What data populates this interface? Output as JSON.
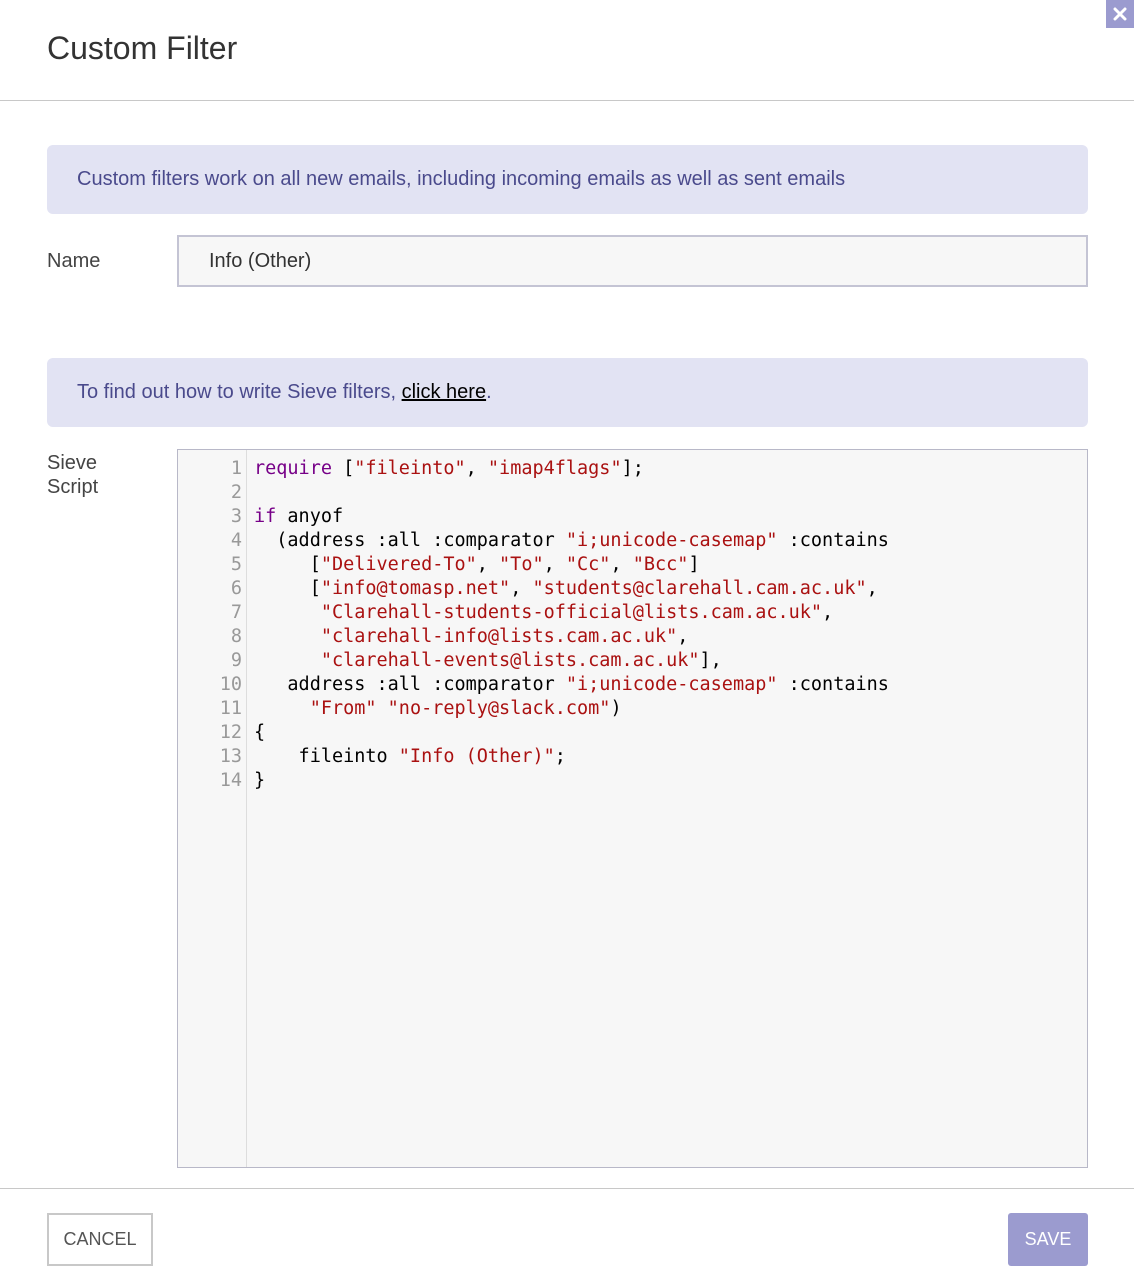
{
  "dialog": {
    "title": "Custom Filter",
    "close_icon": "close-icon"
  },
  "info_banner": {
    "text": "Custom filters work on all new emails, including incoming emails as well as sent emails"
  },
  "name_field": {
    "label": "Name",
    "value": "Info (Other)"
  },
  "help_banner": {
    "prefix": "To find out how to write Sieve filters, ",
    "link_text": "click here",
    "suffix": "."
  },
  "sieve_field": {
    "label": "Sieve Script",
    "lines": [
      [
        {
          "t": "require",
          "c": "kw"
        },
        {
          "t": " ["
        },
        {
          "t": "\"fileinto\"",
          "c": "str"
        },
        {
          "t": ", "
        },
        {
          "t": "\"imap4flags\"",
          "c": "str"
        },
        {
          "t": "];"
        }
      ],
      [],
      [
        {
          "t": "if",
          "c": "kw"
        },
        {
          "t": " anyof"
        }
      ],
      [
        {
          "t": "  (address :all :comparator "
        },
        {
          "t": "\"i;unicode-casemap\"",
          "c": "str"
        },
        {
          "t": " :contains"
        }
      ],
      [
        {
          "t": "     ["
        },
        {
          "t": "\"Delivered-To\"",
          "c": "str"
        },
        {
          "t": ", "
        },
        {
          "t": "\"To\"",
          "c": "str"
        },
        {
          "t": ", "
        },
        {
          "t": "\"Cc\"",
          "c": "str"
        },
        {
          "t": ", "
        },
        {
          "t": "\"Bcc\"",
          "c": "str"
        },
        {
          "t": "]"
        }
      ],
      [
        {
          "t": "     ["
        },
        {
          "t": "\"info@tomasp.net\"",
          "c": "str"
        },
        {
          "t": ", "
        },
        {
          "t": "\"students@clarehall.cam.ac.uk\"",
          "c": "str"
        },
        {
          "t": ","
        }
      ],
      [
        {
          "t": "      "
        },
        {
          "t": "\"Clarehall-students-official@lists.cam.ac.uk\"",
          "c": "str"
        },
        {
          "t": ","
        }
      ],
      [
        {
          "t": "      "
        },
        {
          "t": "\"clarehall-info@lists.cam.ac.uk\"",
          "c": "str"
        },
        {
          "t": ","
        }
      ],
      [
        {
          "t": "      "
        },
        {
          "t": "\"clarehall-events@lists.cam.ac.uk\"",
          "c": "str"
        },
        {
          "t": "],"
        }
      ],
      [
        {
          "t": "   address :all :comparator "
        },
        {
          "t": "\"i;unicode-casemap\"",
          "c": "str"
        },
        {
          "t": " :contains"
        }
      ],
      [
        {
          "t": "     "
        },
        {
          "t": "\"From\"",
          "c": "str"
        },
        {
          "t": " "
        },
        {
          "t": "\"no-reply@slack.com\"",
          "c": "str"
        },
        {
          "t": ")"
        }
      ],
      [
        {
          "t": "{"
        }
      ],
      [
        {
          "t": "    fileinto "
        },
        {
          "t": "\"Info (Other)\"",
          "c": "str"
        },
        {
          "t": ";"
        }
      ],
      [
        {
          "t": "}"
        }
      ]
    ]
  },
  "buttons": {
    "cancel": "CANCEL",
    "save": "SAVE"
  },
  "colors": {
    "accent": "#9b9bcf",
    "banner_bg": "#e2e3f3",
    "banner_text": "#4a4a8c",
    "keyword": "#770088",
    "string": "#aa1111"
  }
}
